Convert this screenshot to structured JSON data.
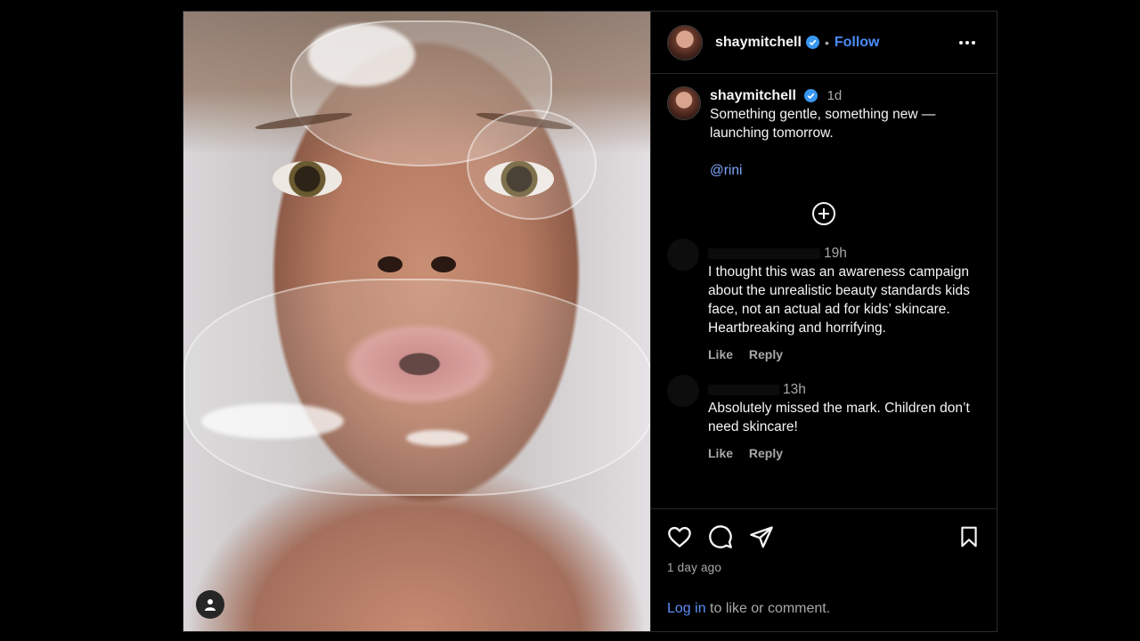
{
  "post": {
    "username": "shaymitchell",
    "follow_label": "Follow",
    "separator": "•"
  },
  "caption": {
    "username": "shaymitchell",
    "time": "1d",
    "text": "Something gentle, something new — launching tomorrow.",
    "mention": "@rini"
  },
  "comments": [
    {
      "time": "19h",
      "text": "I thought this was an awareness campaign about the unrealistic beauty standards kids face, not an actual ad for kids’ skincare. Heartbreaking and horrifying.",
      "like_label": "Like",
      "reply_label": "Reply"
    },
    {
      "time": "13h",
      "text": "Absolutely missed the mark. Children don’t need skincare!",
      "like_label": "Like",
      "reply_label": "Reply"
    }
  ],
  "footer": {
    "posted_ago": "1 day ago",
    "login_link": "Log in",
    "login_suffix": " to like or comment."
  },
  "colors": {
    "link": "#4a8cf7",
    "verified": "#3897f0",
    "muted": "#a8a8a8"
  },
  "icons": [
    "user-tag-icon",
    "verified-badge-icon",
    "more-options-icon",
    "load-more-comments-icon",
    "heart-icon",
    "comment-icon",
    "share-icon",
    "bookmark-icon"
  ]
}
